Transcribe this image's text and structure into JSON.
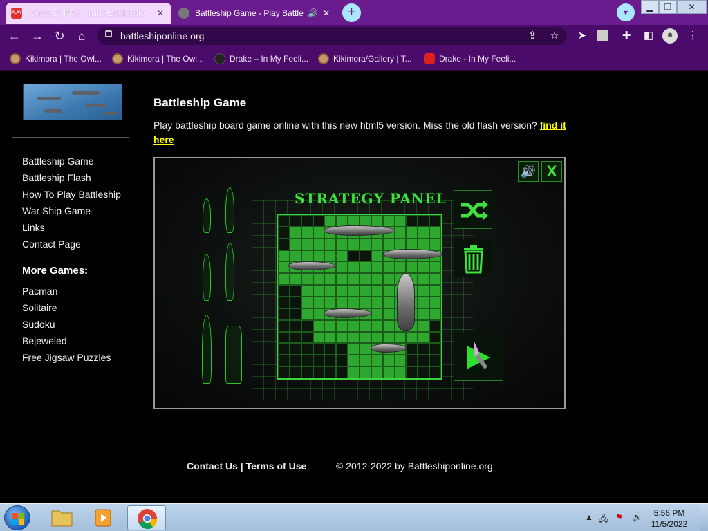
{
  "browser": {
    "tabs": [
      {
        "title": "Where to Play Online Battleship",
        "favicon": "red-tab-favicon",
        "active": false
      },
      {
        "title": "Battleship Game - Play Battle",
        "favicon": "globe-favicon",
        "active": true,
        "audio": true
      }
    ],
    "address": "battleshiponline.org",
    "bookmarks": [
      {
        "label": "Kikimora | The Owl...",
        "icon": "owl-bookmark-icon"
      },
      {
        "label": "Kikimora | The Owl...",
        "icon": "owl-bookmark-icon"
      },
      {
        "label": "Drake – In My Feeli...",
        "icon": "drake-bookmark-icon"
      },
      {
        "label": "Kikimora/Gallery | T...",
        "icon": "owl-bookmark-icon"
      },
      {
        "label": "Drake - In My Feeli...",
        "icon": "youtube-bookmark-icon"
      }
    ],
    "accent": "#6a1b8e"
  },
  "sidebar": {
    "links": [
      "Battleship Game",
      "Battleship Flash",
      "How To Play Battleship",
      "War Ship Game",
      "Links",
      "Contact Page"
    ],
    "more_heading": "More Games:",
    "more_links": [
      "Pacman",
      "Solitaire",
      "Sudoku",
      "Bejeweled",
      "Free Jigsaw Puzzles"
    ]
  },
  "main": {
    "title": "Battleship Game",
    "intro": "Play battleship board game online with this new html5 version. Miss the old flash version?",
    "intro_link": "find it here"
  },
  "game": {
    "panel_title": "STRATEGY PANEL",
    "close_label": "X",
    "accent": "#3fe03f"
  },
  "footer": {
    "contact": "Contact Us",
    "separator": "|",
    "terms": "Terms of Use",
    "copyright": "© 2012-2022 by Battleshiponline.org"
  },
  "taskbar": {
    "time": "5:55 PM",
    "date": "11/5/2022"
  }
}
